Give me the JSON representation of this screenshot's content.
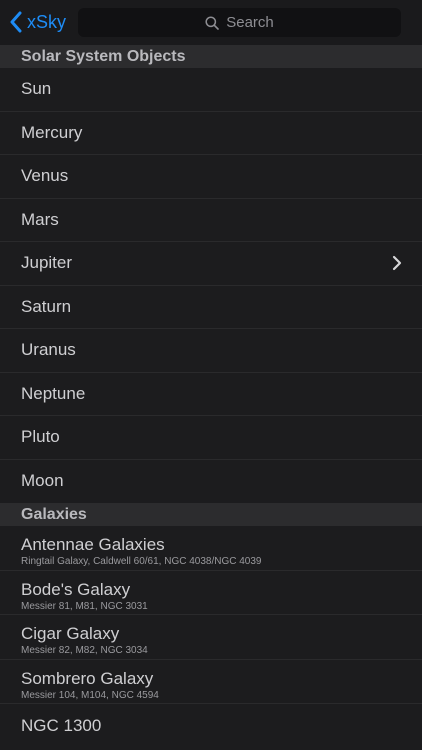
{
  "nav": {
    "back_label": "xSky",
    "search_placeholder": "Search"
  },
  "sections": [
    {
      "header": "Solar System Objects",
      "items": [
        {
          "title": "Sun"
        },
        {
          "title": "Mercury"
        },
        {
          "title": "Venus"
        },
        {
          "title": "Mars"
        },
        {
          "title": "Jupiter",
          "chevron": true
        },
        {
          "title": "Saturn"
        },
        {
          "title": "Uranus"
        },
        {
          "title": "Neptune"
        },
        {
          "title": "Pluto"
        },
        {
          "title": "Moon"
        }
      ]
    },
    {
      "header": "Galaxies",
      "items": [
        {
          "title": "Antennae Galaxies",
          "subtitle": "Ringtail Galaxy, Caldwell 60/61, NGC 4038/NGC 4039"
        },
        {
          "title": "Bode's Galaxy",
          "subtitle": "Messier 81, M81, NGC 3031"
        },
        {
          "title": "Cigar Galaxy",
          "subtitle": "Messier 82, M82, NGC 3034"
        },
        {
          "title": "Sombrero Galaxy",
          "subtitle": "Messier 104, M104, NGC 4594"
        },
        {
          "title": "NGC 1300"
        }
      ]
    }
  ],
  "colors": {
    "accent": "#1e8cf5",
    "background": "#1c1c1e",
    "section_header_bg": "#2c2c2e"
  },
  "icons": {
    "back": "chevron-left-icon",
    "search": "search-icon",
    "disclosure": "chevron-right-icon"
  }
}
